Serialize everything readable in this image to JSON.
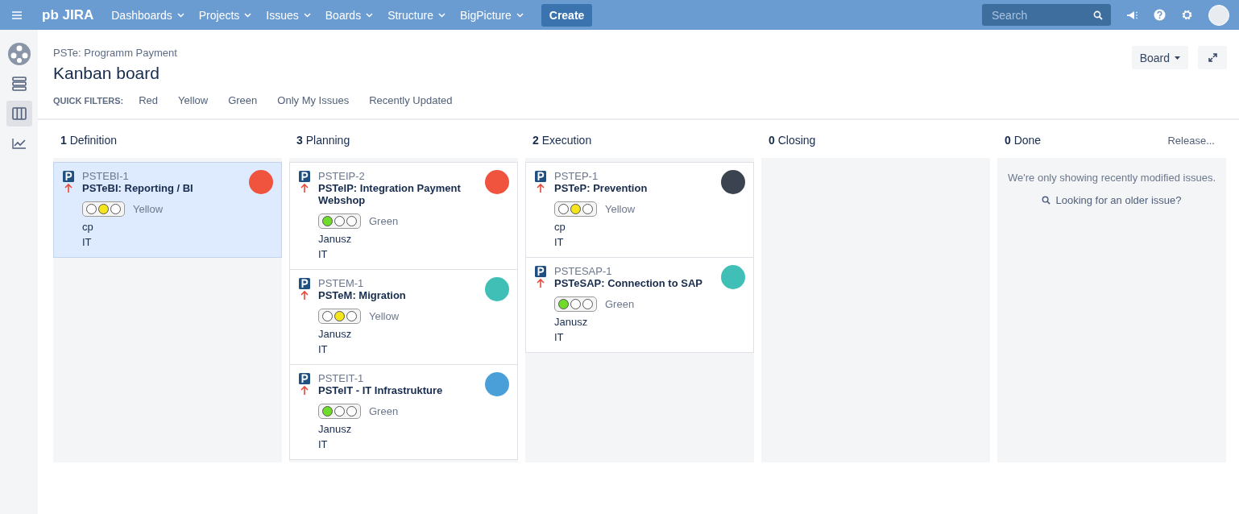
{
  "topbar": {
    "logo": "pb JIRA",
    "menus": [
      "Dashboards",
      "Projects",
      "Issues",
      "Boards",
      "Structure",
      "BigPicture"
    ],
    "create": "Create",
    "search": {
      "placeholder": "Search"
    }
  },
  "sidebar": {
    "items": [
      {
        "kind": "logo",
        "selected": false
      },
      {
        "kind": "backlog",
        "selected": false
      },
      {
        "kind": "board",
        "selected": true
      },
      {
        "kind": "reports",
        "selected": false
      }
    ]
  },
  "header": {
    "breadcrumb": "PSTe: Programm Payment",
    "title": "Kanban board",
    "board_button": "Board",
    "quick_filters_label": "QUICK FILTERS:",
    "quick_filters": [
      "Red",
      "Yellow",
      "Green",
      "Only My Issues",
      "Recently Updated"
    ]
  },
  "columns": [
    {
      "count": "1",
      "name": "Definition",
      "cards": [
        {
          "key": "PSTEBI-1",
          "summary": "PSTeBI: Reporting / BI",
          "lamps": [
            {
              "color": "#ffffff"
            },
            {
              "color": "#f5e61c"
            },
            {
              "color": "#ffffff"
            }
          ],
          "status": "Yellow",
          "assignee": "cp",
          "team": "IT",
          "selected": true,
          "avatar": {
            "color": "#f0533e"
          }
        }
      ]
    },
    {
      "count": "3",
      "name": "Planning",
      "cards": [
        {
          "key": "PSTEIP-2",
          "summary": "PSTeIP: Integration Payment Webshop",
          "lamps": [
            {
              "color": "#6fdc2c"
            },
            {
              "color": "#ffffff"
            },
            {
              "color": "#ffffff"
            }
          ],
          "status": "Green",
          "assignee": "Janusz",
          "team": "IT",
          "selected": false,
          "avatar": {
            "color": "#f0533e"
          }
        },
        {
          "key": "PSTEM-1",
          "summary": "PSTeM: Migration",
          "lamps": [
            {
              "color": "#ffffff"
            },
            {
              "color": "#f5e61c"
            },
            {
              "color": "#ffffff"
            }
          ],
          "status": "Yellow",
          "assignee": "Janusz",
          "team": "IT",
          "selected": false,
          "avatar": {
            "color": "#3fbfb5"
          }
        },
        {
          "key": "PSTEIT-1",
          "summary": "PSTeIT - IT Infrastrukture",
          "lamps": [
            {
              "color": "#6fdc2c"
            },
            {
              "color": "#ffffff"
            },
            {
              "color": "#ffffff"
            }
          ],
          "status": "Green",
          "assignee": "Janusz",
          "team": "IT",
          "selected": false,
          "avatar": {
            "color": "#4a9fd8"
          }
        }
      ]
    },
    {
      "count": "2",
      "name": "Execution",
      "cards": [
        {
          "key": "PSTEP-1",
          "summary": "PSTeP: Prevention",
          "lamps": [
            {
              "color": "#ffffff"
            },
            {
              "color": "#f5e61c"
            },
            {
              "color": "#ffffff"
            }
          ],
          "status": "Yellow",
          "assignee": "cp",
          "team": "IT",
          "selected": false,
          "avatar": {
            "color": "#3b4350"
          }
        },
        {
          "key": "PSTESAP-1",
          "summary": "PSTeSAP: Connection to SAP",
          "lamps": [
            {
              "color": "#6fdc2c"
            },
            {
              "color": "#ffffff"
            },
            {
              "color": "#ffffff"
            }
          ],
          "status": "Green",
          "assignee": "Janusz",
          "team": "IT",
          "selected": false,
          "avatar": {
            "color": "#3fbfb5"
          }
        }
      ]
    },
    {
      "count": "0",
      "name": "Closing"
    },
    {
      "count": "0",
      "name": "Done",
      "release": "Release...",
      "empty_message": "We're only showing recently modified issues.",
      "older_link": "Looking for an older issue?"
    }
  ]
}
